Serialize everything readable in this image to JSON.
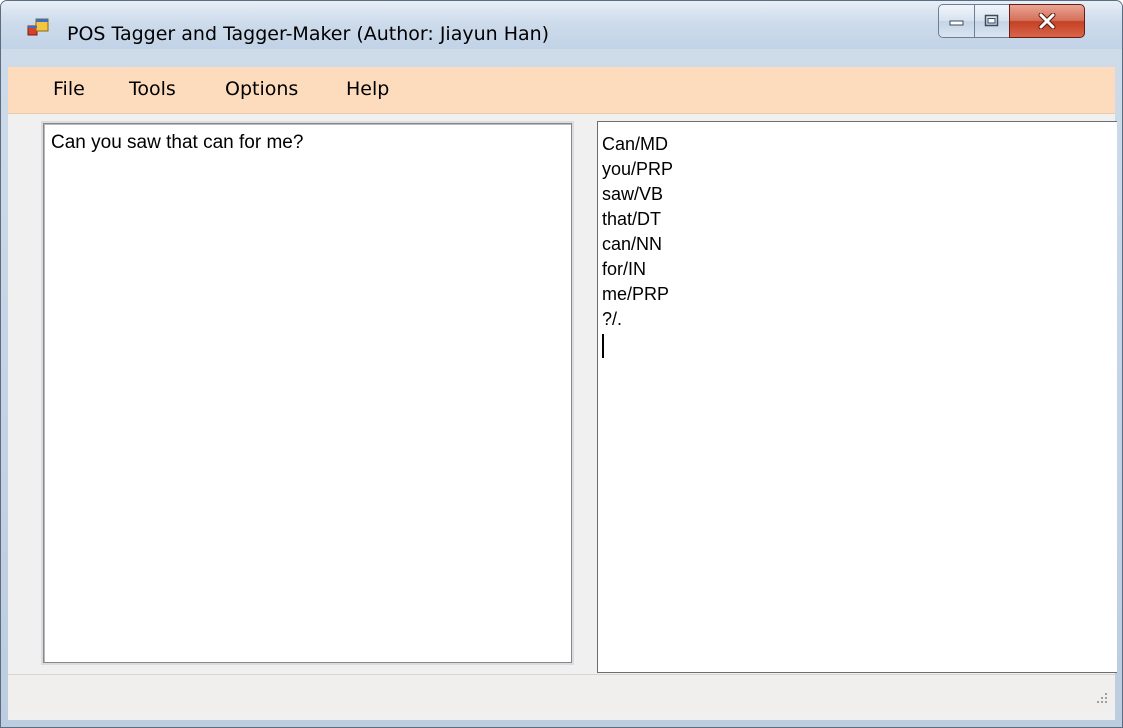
{
  "window": {
    "title": "POS Tagger and Tagger-Maker (Author: Jiayun Han)",
    "icon": "app-window-icon",
    "controls": {
      "minimize_icon": "minimize-icon",
      "maximize_icon": "maximize-icon",
      "close_icon": "close-icon"
    }
  },
  "menubar": {
    "background": "#fcdcbd",
    "items": [
      {
        "label": "File"
      },
      {
        "label": "Tools"
      },
      {
        "label": "Options"
      },
      {
        "label": "Help"
      }
    ]
  },
  "input_text": {
    "value": "Can you saw that can for me?"
  },
  "output_text": {
    "lines": [
      "Can/MD",
      "you/PRP",
      "saw/VB",
      "that/DT",
      "can/NN",
      "for/IN",
      "me/PRP",
      "?/."
    ]
  },
  "statusbar": {
    "grip_icon": "resize-grip-icon"
  }
}
